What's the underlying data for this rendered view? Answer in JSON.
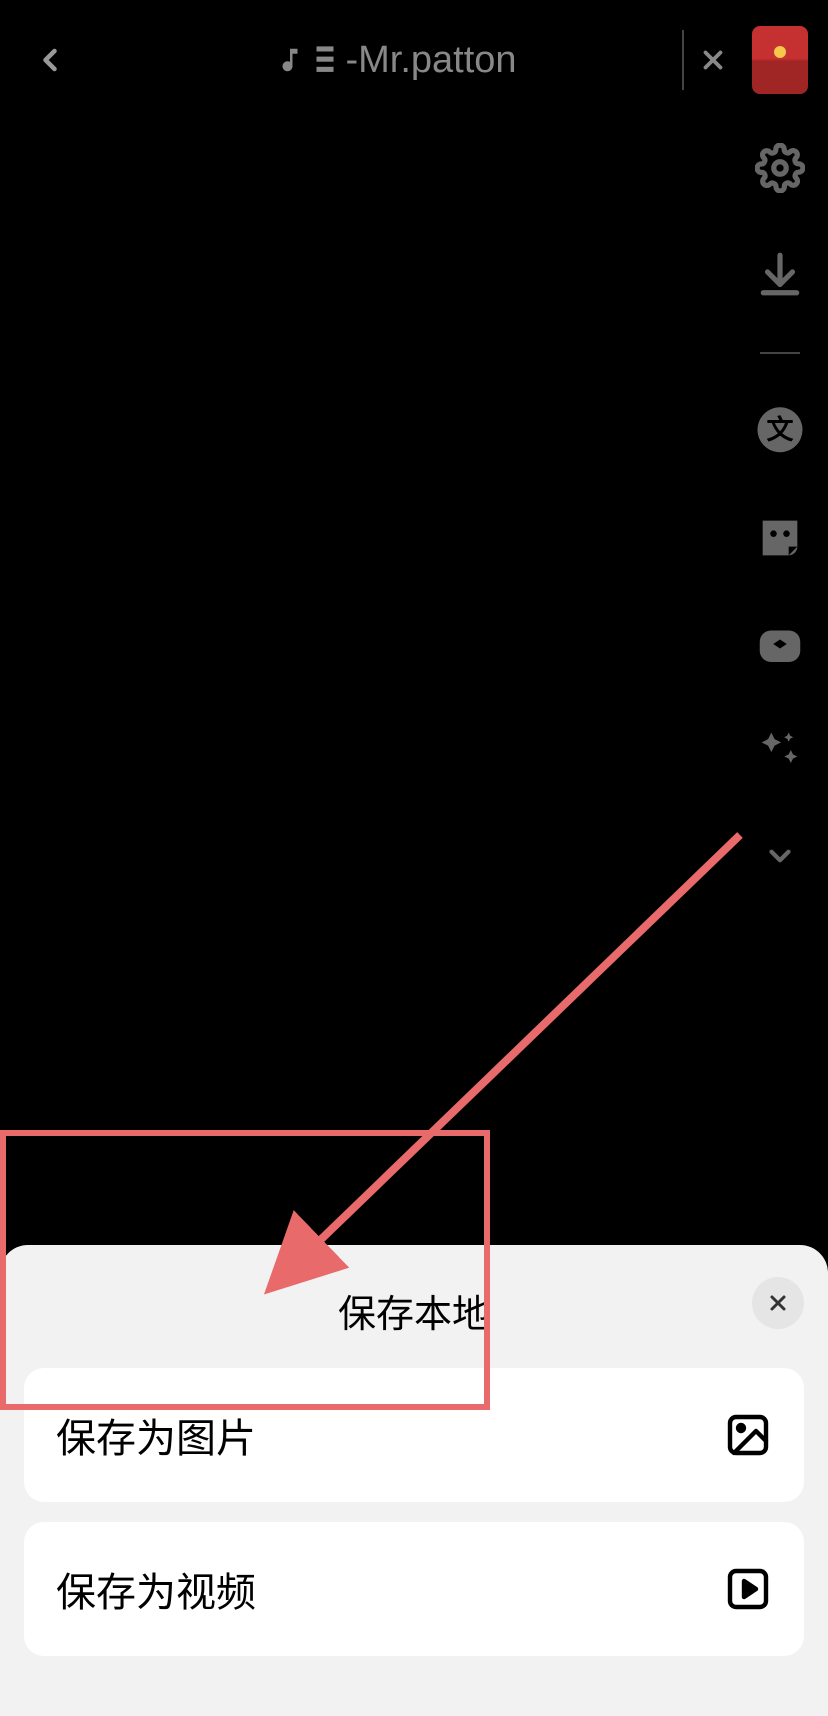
{
  "header": {
    "title": "-Mr.patton"
  },
  "sheet": {
    "title": "保存本地",
    "items": [
      {
        "label": "保存为图片"
      },
      {
        "label": "保存为视频"
      }
    ]
  },
  "annotation": {
    "box_color": "#e86a6a"
  }
}
